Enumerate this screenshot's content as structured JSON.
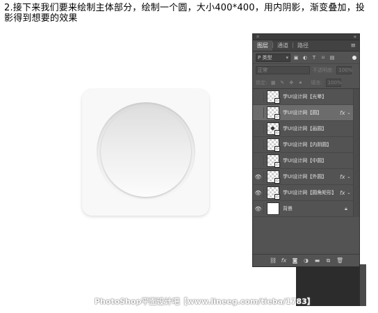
{
  "instruction_text": "2.接下来我们要来绘制主体部分，绘制一个圆，大小400*400，用内阴影，渐变叠加，投影得到想要的效果",
  "panel": {
    "tabs": [
      "图层",
      "通道",
      "路径"
    ],
    "active_tab": "图层",
    "filter_kind": "P 类型",
    "blend_mode": "正常",
    "opacity_label": "不透明度:",
    "opacity_value": "100%",
    "lock_label": "锁定:",
    "fill_label": "填充:",
    "fill_value": "100%",
    "layers": [
      {
        "name": "学UI设计网【光晕】",
        "visible": false,
        "fx": false,
        "selected": false,
        "thumb": "checker",
        "badge": true
      },
      {
        "name": "学UI设计网【圆】",
        "visible": false,
        "fx": true,
        "selected": true,
        "thumb": "checker",
        "badge": true
      },
      {
        "name": "学UI设计网【画圆】",
        "visible": false,
        "fx": false,
        "selected": false,
        "thumb": "checker-dot",
        "badge": true
      },
      {
        "name": "学UI设计网【内阴圆】",
        "visible": false,
        "fx": false,
        "selected": false,
        "thumb": "checker",
        "badge": true
      },
      {
        "name": "学UI设计网【中圆】",
        "visible": false,
        "fx": false,
        "selected": false,
        "thumb": "checker",
        "badge": true
      },
      {
        "name": "学UI设计网【外圆】",
        "visible": true,
        "fx": true,
        "selected": false,
        "thumb": "checker",
        "badge": true
      },
      {
        "name": "学UI设计网【圆角矩形】",
        "visible": true,
        "fx": true,
        "selected": false,
        "thumb": "checker",
        "badge": true
      },
      {
        "name": "背景",
        "visible": true,
        "fx": false,
        "selected": false,
        "thumb": "white",
        "badge": false,
        "locked": true
      }
    ],
    "bottom_icons": [
      "link-icon",
      "fx-icon",
      "mask-icon",
      "adjustment-icon",
      "folder-icon",
      "new-layer-icon",
      "trash-icon"
    ]
  },
  "watermark": "PhotoShop平面设计吧【www.lineeg.com/tieba/1783】",
  "colors": {
    "panel_bg": "#535353",
    "selected_row": "#6c6c6c",
    "canvas_bg": "#ffffff"
  }
}
